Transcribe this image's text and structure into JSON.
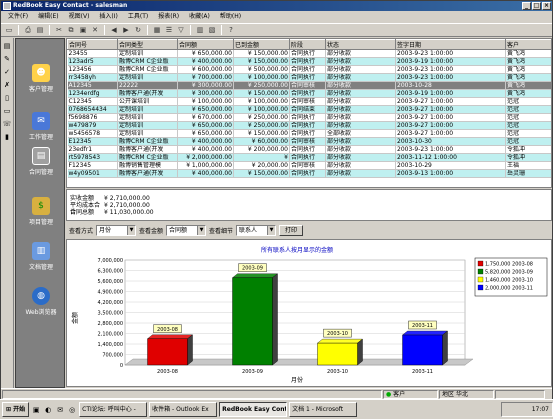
{
  "window": {
    "title": "RedBook Easy Contact - salesman"
  },
  "menu": [
    "文件(F)",
    "编辑(E)",
    "视图(V)",
    "插入(I)",
    "工具(T)",
    "报表(R)",
    "收藏(A)",
    "帮助(H)"
  ],
  "toolbar": {
    "help_label": "?"
  },
  "left_strip": {
    "bottom_label": "标准"
  },
  "outlook_bar": [
    {
      "label": "客户管理",
      "icon": "customers-icon"
    },
    {
      "label": "工作管理",
      "icon": "work-icon"
    },
    {
      "label": "合同管理",
      "icon": "contract-icon"
    },
    {
      "label": "项目管理",
      "icon": "project-icon"
    },
    {
      "label": "文档管理",
      "icon": "document-icon"
    },
    {
      "label": "Web浏览器",
      "icon": "web-browser-icon"
    }
  ],
  "grid": {
    "columns": [
      "合同号",
      "合同类型",
      "合同额",
      "已到金额",
      "阶段",
      "状态",
      "签字日期",
      "客户"
    ],
    "rows": [
      {
        "style": "plain",
        "cells": [
          "23455",
          "定制培训",
          "¥ 650,000.00",
          "¥ 150,000.00",
          "合同执行",
          "部分收款",
          "2003-9-23 1:00:00",
          "黄飞鸿"
        ]
      },
      {
        "style": "cyan",
        "cells": [
          "123adr5",
          "融博CRM C企业版",
          "¥ 400,000.00",
          "¥ 150,000.00",
          "合同执行",
          "部分收款",
          "2003-9-19 1:00:00",
          "黄飞鸿"
        ]
      },
      {
        "style": "plain",
        "cells": [
          "123456",
          "融博CRM C企业版",
          "¥ 600,000.00",
          "¥ 500,000.00",
          "合同执行",
          "部分收款",
          "2003-9-23 1:00:00",
          "黄飞鸿"
        ]
      },
      {
        "style": "cyan",
        "cells": [
          "rr3458yh",
          "定制培训",
          "¥ 700,000.00",
          "¥ 100,000.00",
          "合同执行",
          "部分收款",
          "2003-9-23 1:00:00",
          "黄飞鸿"
        ]
      },
      {
        "style": "sel",
        "cells": [
          "A12345",
          "22222",
          "¥ 300,000.00",
          "¥ 250,000.00",
          "合同审核",
          "部分收款",
          "2003-10-28",
          "黄飞鸿"
        ]
      },
      {
        "style": "cyan",
        "cells": [
          "1234erdfg",
          "融博客户通(开发",
          "¥ 300,000.00",
          "¥ 150,000.00",
          "合同执行",
          "部分收款",
          "2003-9-19 1:00:00",
          "黄飞鸿"
        ]
      },
      {
        "style": "plain",
        "cells": [
          "C12345",
          "公开课培训",
          "¥ 100,000.00",
          "¥ 100,000.00",
          "合同审核",
          "部分收款",
          "2003-9-27 1:00:00",
          "范冠"
        ]
      },
      {
        "style": "cyan",
        "cells": [
          "0768654434",
          "定制培训",
          "¥ 650,000.00",
          "¥ 100,000.00",
          "合同结束",
          "部分收款",
          "2003-9-27 1:00:00",
          "范冠"
        ]
      },
      {
        "style": "plain",
        "cells": [
          "f5698876",
          "定制培训",
          "¥ 670,000.00",
          "¥ 250,000.00",
          "合同执行",
          "部分收款",
          "2003-9-27 1:00:00",
          "范冠"
        ]
      },
      {
        "style": "cyan",
        "cells": [
          "w479879",
          "定制培训",
          "¥ 650,000.00",
          "¥ 250,000.00",
          "合同执行",
          "部分收款",
          "2003-9-27 1:00:00",
          "范冠"
        ]
      },
      {
        "style": "plain",
        "cells": [
          "w5456578",
          "定制培训",
          "¥ 650,000.00",
          "¥ 150,000.00",
          "合同执行",
          "全部收款",
          "2003-9-27 1:00:00",
          "范冠"
        ]
      },
      {
        "style": "cyan",
        "cells": [
          "E12345",
          "融博CRM C企业版",
          "¥ 400,000.00",
          "¥ 60,000.00",
          "合同审核",
          "部分收款",
          "2003-10-30",
          "范冠"
        ]
      },
      {
        "style": "plain",
        "cells": [
          "23edfr1",
          "融博客户通(开发",
          "¥ 400,000.00",
          "¥ 200,000.00",
          "合同执行",
          "部分收款",
          "2003-9-23 1:00:00",
          "令狐冲"
        ]
      },
      {
        "style": "cyan",
        "cells": [
          "rt5978543",
          "融博CRM C企业版",
          "¥ 2,000,000.00",
          "¥",
          "合同执行",
          "部分收款",
          "2003-11-12 1:00:00",
          "令狐冲"
        ]
      },
      {
        "style": "plain",
        "cells": [
          "F12345",
          "融博销售管理模",
          "¥ 1,000,000.00",
          "¥ 20,000.00",
          "合同审核",
          "部分收款",
          "2003-10-29",
          "王福"
        ]
      },
      {
        "style": "cyan",
        "cells": [
          "w4y09501",
          "融博客户通(开发",
          "¥ 400,000.00",
          "¥ 150,000.00",
          "合同执行",
          "部分收款",
          "2003-9-13 1:00:00",
          "岳灵珊"
        ]
      }
    ]
  },
  "summary": [
    {
      "label": "实收金额",
      "value": "¥ 2,710,000.00"
    },
    {
      "label": "平均成本合计",
      "value": "¥ 2,710,000.00"
    },
    {
      "label": "合同总额",
      "value": "¥ 11,030,000.00"
    }
  ],
  "filters": {
    "view_mode_label": "查看方式",
    "view_mode_value": "月份",
    "amount_label": "查看金额",
    "amount_value": "合同额",
    "detail_label": "查看细节",
    "detail_value": "联系人",
    "print_label": "打印"
  },
  "chart_data": {
    "type": "bar",
    "title": "所有联系人按月显示的金额",
    "xlabel": "月份",
    "ylabel": "金额",
    "categories": [
      "2003-08",
      "2003-09",
      "2003-10",
      "2003-11"
    ],
    "values": [
      1750000,
      5820000,
      1460000,
      2000000
    ],
    "bar_labels": [
      "2003-08",
      "2003-09",
      "2003-10",
      "2003-11"
    ],
    "colors": [
      "#e00000",
      "#008000",
      "#ffff00",
      "#0000ff"
    ],
    "ylim": [
      0,
      7000000
    ],
    "yticks": [
      0,
      700000,
      1400000,
      2100000,
      2800000,
      3500000,
      4200000,
      4900000,
      5600000,
      6300000,
      7000000
    ],
    "ytick_labels": [
      "0",
      "700,000",
      "1,400,000",
      "2,100,000",
      "2,800,000",
      "3,500,000",
      "4,200,000",
      "4,900,000",
      "5,600,000",
      "6,300,000",
      "7,000,000"
    ],
    "legend": [
      "1,750,000 2003-08",
      "5,820,000 2003-09",
      "1,460,000 2003-10",
      "2,000,000 2003-11"
    ],
    "legend_position": "right"
  },
  "statusbar": {
    "user": "客户",
    "area": "华北",
    "region_label": "地区"
  },
  "taskbar": {
    "start": "开始",
    "tasks": [
      "CTI论坛: 呼叫中心 -",
      "收件箱 - Outlook Ex",
      "RedBook Easy Contac",
      "文档 1 - Microsoft"
    ],
    "clock": "17:07"
  }
}
